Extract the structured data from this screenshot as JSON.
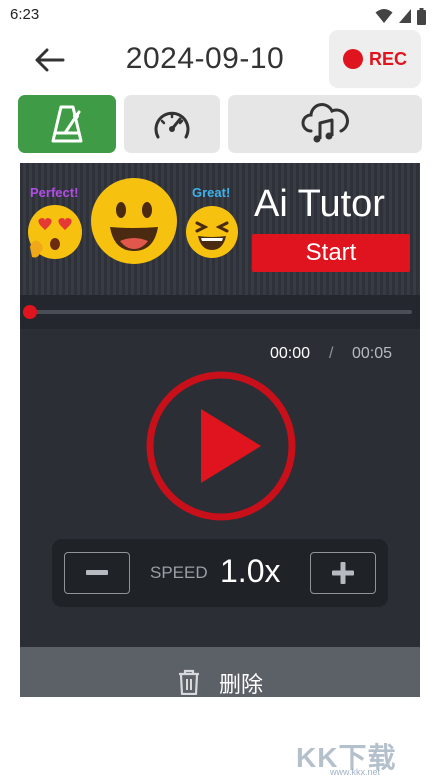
{
  "status_bar": {
    "time": "6:23",
    "icons": [
      "wifi-icon",
      "signal-icon",
      "battery-icon"
    ]
  },
  "header": {
    "back_icon": "arrow-left-icon",
    "title": "2024-09-10",
    "rec_label": "REC"
  },
  "tabs": [
    {
      "icon": "metronome-icon",
      "active": true
    },
    {
      "icon": "speedometer-icon",
      "active": false
    },
    {
      "icon": "cloud-music-icon",
      "active": false
    }
  ],
  "banner": {
    "label_left": "Perfect!",
    "label_right": "Great!",
    "title": "Ai Tutor",
    "start_label": "Start"
  },
  "playback": {
    "progress": 0.0,
    "current_time": "00:00",
    "separator": "/",
    "total_time": "00:05"
  },
  "speed": {
    "label": "SPEED",
    "value": "1.0x"
  },
  "delete": {
    "label": "删除",
    "icon": "trash-icon"
  },
  "watermark": {
    "text": "KK下载",
    "url": "www.kkx.net"
  },
  "colors": {
    "accent_red": "#e0141e",
    "tab_active": "#3f9b46",
    "panel_bg": "#2b2e35"
  }
}
